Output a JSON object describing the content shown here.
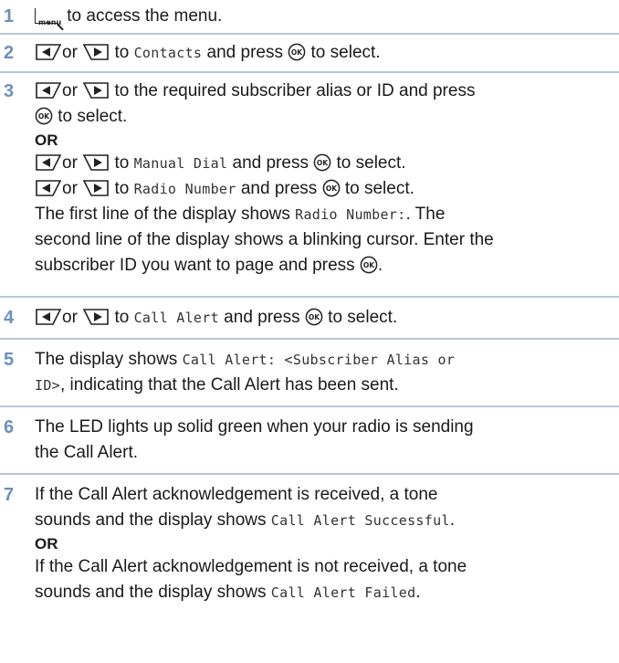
{
  "step1": {
    "number": "1",
    "text": " to access the menu."
  },
  "step2": {
    "number": "2",
    "t1": "or ",
    "t2": " to ",
    "mono": "Contacts",
    "t3": " and press ",
    "t4": " to select."
  },
  "step3": {
    "number": "3",
    "a1": "or ",
    "a2": " to the required subscriber alias or ID and press",
    "a3": " to select.",
    "or1": "OR",
    "b1": "or ",
    "b2": " to ",
    "bmono": "Manual Dial",
    "b3": " and press ",
    "b4": " to select.",
    "c1": "or ",
    "c2": " to ",
    "cmono": "Radio Number",
    "c3": " and press ",
    "c4": " to select.",
    "d1": "The first line of the display shows ",
    "dmono": "Radio Number:",
    "d2": ". The",
    "e1": "second line of the display shows a blinking cursor. Enter the",
    "f1": "subscriber ID you want to page and press ",
    "f2": "."
  },
  "step4": {
    "number": "4",
    "t1": "or ",
    "t2": " to ",
    "mono": "Call Alert",
    "t3": " and press ",
    "t4": " to select."
  },
  "step5": {
    "number": "5",
    "t1": "The display shows ",
    "mono1": "Call Alert: <Subscriber Alias or",
    "mono2": "ID>",
    "t2": ", indicating that the Call Alert has been sent."
  },
  "step6": {
    "number": "6",
    "l1": "The LED lights up solid green when your radio is sending",
    "l2": "the Call Alert."
  },
  "step7": {
    "number": "7",
    "l1": "If the Call Alert acknowledgement is received, a tone",
    "l2": "sounds and the display shows ",
    "mono1": "Call Alert Successful",
    "l2end": ".",
    "or": "OR",
    "l3": "If the Call Alert acknowledgement is not received, a tone",
    "l4": "sounds and the display shows ",
    "mono2": "Call Alert Failed",
    "l4end": "."
  },
  "icons": {
    "menu_key_label": "menu",
    "ok_label": "OK"
  },
  "colors": {
    "step_number": "#6c8fbe",
    "separator": "#b9c6dc"
  }
}
